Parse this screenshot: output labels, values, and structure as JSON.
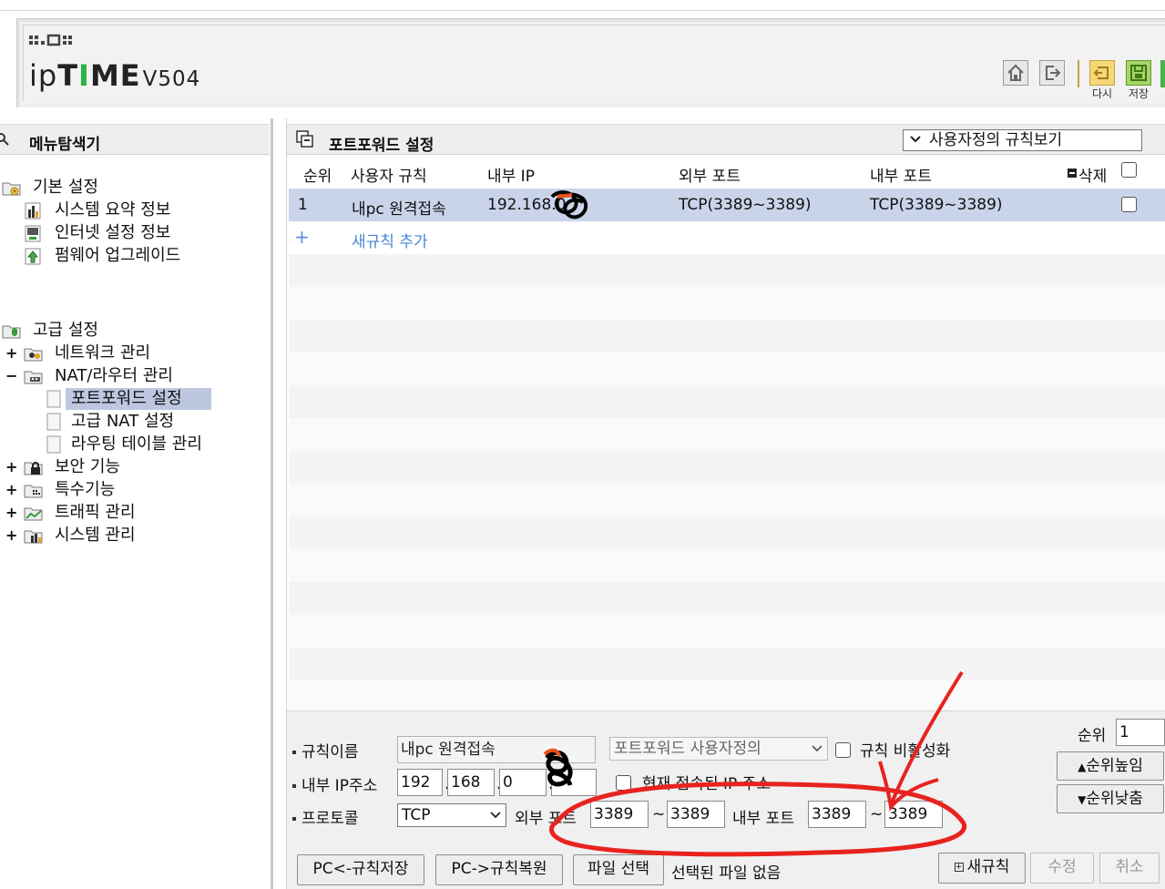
{
  "header": {
    "product": "ipTIME",
    "model": "V504",
    "buttons": [
      {
        "name": "home",
        "icon": "home-icon"
      },
      {
        "name": "logout",
        "icon": "logout-icon"
      },
      {
        "name": "retry",
        "icon": "retry-icon",
        "label": "다시"
      },
      {
        "name": "save",
        "icon": "save-icon",
        "label": "저장"
      }
    ]
  },
  "sidebar": {
    "title": "메뉴탐색기",
    "basic": {
      "label": "기본 설정",
      "items": [
        "시스템 요약 정보",
        "인터넷 설정 정보",
        "펌웨어 업그레이드"
      ]
    },
    "advanced": {
      "label": "고급 설정",
      "items": [
        {
          "label": "네트워크 관리",
          "expander": "+"
        },
        {
          "label": "NAT/라우터 관리",
          "expander": "−"
        },
        {
          "label": "보안 기능",
          "expander": "+"
        },
        {
          "label": "특수기능",
          "expander": "+"
        },
        {
          "label": "트래픽 관리",
          "expander": "+"
        },
        {
          "label": "시스템 관리",
          "expander": "+"
        }
      ],
      "nat_children": [
        "포트포워드 설정",
        "고급 NAT 설정",
        "라우팅 테이블 관리"
      ]
    }
  },
  "main": {
    "title": "포트포워드 설정",
    "view_select": "사용자정의 규칙보기",
    "columns": [
      "순위",
      "사용자 규칙",
      "내부 IP",
      "외부 포트",
      "내부 포트",
      "삭제"
    ],
    "rules": [
      {
        "order": "1",
        "name": "내pc 원격접속",
        "internal_ip": "192.168.0",
        "external_port": "TCP(3389~3389)",
        "internal_port": "TCP(3389~3389)"
      }
    ],
    "add_rule": "새규칙 추가"
  },
  "form": {
    "rule_name_label": "규칙이름",
    "rule_name_value": "내pc 원격접속",
    "rule_type": "포트포워드 사용자정의",
    "disable_label": "규칙 비활성화",
    "ip_label": "내부 IP주소",
    "ip": [
      "192",
      "168",
      "0",
      ""
    ],
    "current_ip_label": "현재 접속된 IP 주소",
    "protocol_label": "프로토콜",
    "protocol": "TCP",
    "ext_port_label": "외부 포트",
    "ext_port_from": "3389",
    "ext_port_to": "3389",
    "int_port_label": "내부 포트",
    "int_port_from": "3389",
    "int_port_to": "3389",
    "tilde": "~",
    "order_label": "순위",
    "order_value": "1",
    "priority_up": "순위높임",
    "priority_down": "순위낮춤",
    "pc_save": "PC<-규칙저장",
    "pc_restore": "PC->규칙복원",
    "file_select": "파일 선택",
    "no_file": "선택된 파일 없음",
    "new_rule": "새규칙",
    "modify": "수정",
    "cancel": "취소"
  },
  "colors": {
    "annotation": "#e8231f",
    "selected_row": "#c9d4ea",
    "brand_green": "#2db34a"
  }
}
